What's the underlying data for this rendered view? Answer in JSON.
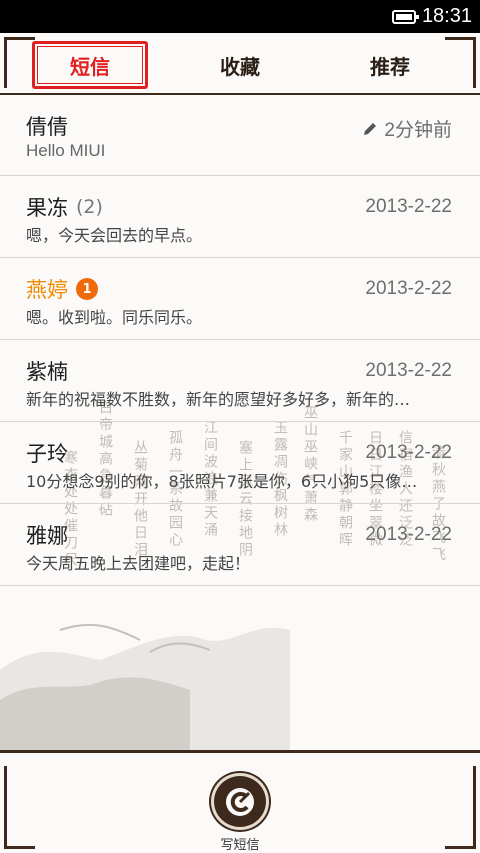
{
  "status": {
    "time": "18:31",
    "battery_icon": "battery-icon"
  },
  "tabs": [
    {
      "label": "短信",
      "active": true
    },
    {
      "label": "收藏",
      "active": false
    },
    {
      "label": "推荐",
      "active": false
    }
  ],
  "messages": [
    {
      "name": "倩倩",
      "count": "",
      "badge": "",
      "time": "2分钟前",
      "draft": true,
      "snippet": "Hello MIUI",
      "unread": false
    },
    {
      "name": "果冻",
      "count": "(2)",
      "badge": "",
      "time": "2013-2-22",
      "draft": false,
      "snippet": "嗯，今天会回去的早点。",
      "unread": false
    },
    {
      "name": "燕婷",
      "count": "",
      "badge": "1",
      "time": "2013-2-22",
      "draft": false,
      "snippet": "嗯。收到啦。同乐同乐。",
      "unread": true
    },
    {
      "name": "紫楠",
      "count": "",
      "badge": "",
      "time": "2013-2-22",
      "draft": false,
      "snippet": "新年的祝福数不胜数，新年的愿望好多好多，新年的…",
      "unread": false
    },
    {
      "name": "子玲",
      "count": "",
      "badge": "",
      "time": "2013-2-22",
      "draft": false,
      "snippet": "10分想念9别的你，8张照片7张是你，6只小狗5只像…",
      "unread": false
    },
    {
      "name": "雅娜",
      "count": "",
      "badge": "",
      "time": "2013-2-22",
      "draft": false,
      "snippet": "今天周五晚上去团建吧，走起！",
      "unread": false
    }
  ],
  "compose": {
    "label": "写短信"
  },
  "colors": {
    "accent": "#e02020",
    "frame": "#3d2a1c",
    "unread": "#f08a00",
    "badge": "#f06a0c"
  }
}
